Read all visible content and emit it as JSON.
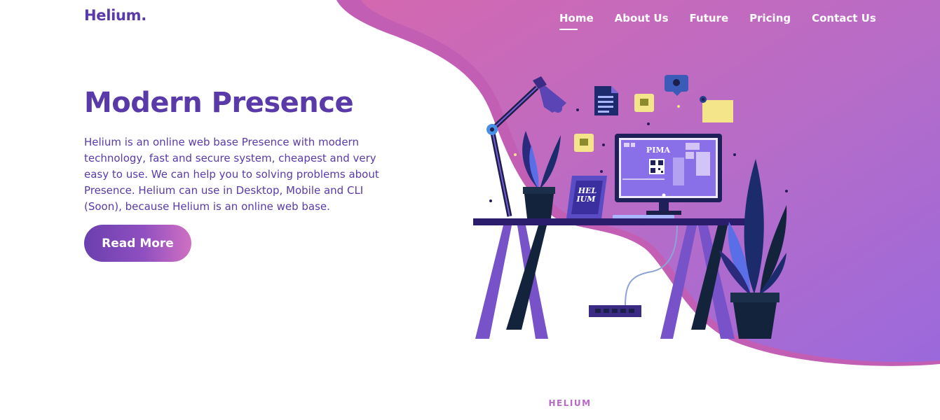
{
  "brand": {
    "logo": "Helium."
  },
  "nav": {
    "items": [
      "Home",
      "About Us",
      "Future",
      "Pricing",
      "Contact Us"
    ],
    "active": "Home"
  },
  "hero": {
    "title": "Modern Presence",
    "description": "Helium is an online web base Presence with modern technology, fast and secure system, cheapest and very easy to use. We can help you to solving problems about Presence. Helium can use in Desktop, Mobile and CLI (Soon), because Helium is an online web base.",
    "button_label": "Read More"
  },
  "illustration": {
    "monitor_label": "PIMA",
    "frame_line1": "HEL",
    "frame_line2": "IUM"
  },
  "section": {
    "label": "HELIUM"
  },
  "colors": {
    "brand_purple": "#5a3aa8",
    "blob_start": "#d06ab4",
    "blob_end": "#9f6ddb",
    "accent_pink": "#b86ac6"
  }
}
